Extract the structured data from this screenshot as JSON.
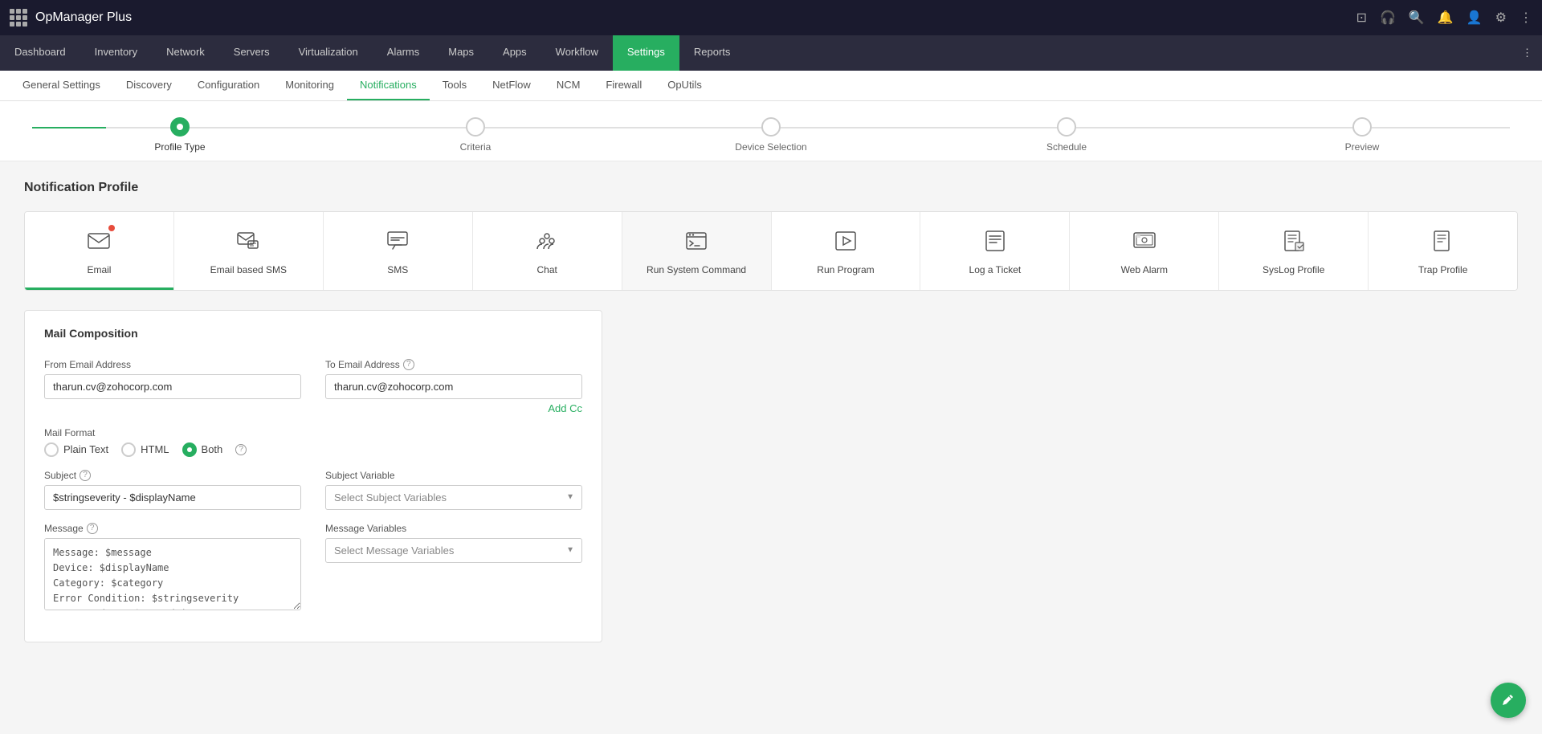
{
  "app": {
    "name": "OpManager Plus"
  },
  "topbar": {
    "icons": [
      "screen-icon",
      "bell-notification-icon",
      "search-icon",
      "bell-icon",
      "user-icon",
      "settings-icon",
      "more-icon"
    ]
  },
  "main_nav": {
    "items": [
      {
        "label": "Dashboard",
        "active": false
      },
      {
        "label": "Inventory",
        "active": false
      },
      {
        "label": "Network",
        "active": false
      },
      {
        "label": "Servers",
        "active": false
      },
      {
        "label": "Virtualization",
        "active": false
      },
      {
        "label": "Alarms",
        "active": false
      },
      {
        "label": "Maps",
        "active": false
      },
      {
        "label": "Apps",
        "active": false
      },
      {
        "label": "Workflow",
        "active": false
      },
      {
        "label": "Settings",
        "active": true
      },
      {
        "label": "Reports",
        "active": false
      }
    ]
  },
  "sub_nav": {
    "items": [
      {
        "label": "General Settings",
        "active": false
      },
      {
        "label": "Discovery",
        "active": false
      },
      {
        "label": "Configuration",
        "active": false
      },
      {
        "label": "Monitoring",
        "active": false
      },
      {
        "label": "Notifications",
        "active": true
      },
      {
        "label": "Tools",
        "active": false
      },
      {
        "label": "NetFlow",
        "active": false
      },
      {
        "label": "NCM",
        "active": false
      },
      {
        "label": "Firewall",
        "active": false
      },
      {
        "label": "OpUtils",
        "active": false
      }
    ]
  },
  "progress": {
    "steps": [
      {
        "label": "Profile Type",
        "active": true
      },
      {
        "label": "Criteria",
        "active": false
      },
      {
        "label": "Device Selection",
        "active": false
      },
      {
        "label": "Schedule",
        "active": false
      },
      {
        "label": "Preview",
        "active": false
      }
    ]
  },
  "page_title": "Notification Profile",
  "notification_types": [
    {
      "key": "email",
      "label": "Email",
      "icon": "email",
      "active": true,
      "badge": true
    },
    {
      "key": "email-sms",
      "label": "Email based SMS",
      "icon": "email-sms",
      "active": false,
      "badge": false
    },
    {
      "key": "sms",
      "label": "SMS",
      "icon": "sms",
      "active": false,
      "badge": false
    },
    {
      "key": "chat",
      "label": "Chat",
      "icon": "chat",
      "active": false,
      "badge": false,
      "dimmed": false
    },
    {
      "key": "run-system-command",
      "label": "Run System Command",
      "icon": "terminal",
      "active": false,
      "badge": false,
      "dimmed": true
    },
    {
      "key": "run-program",
      "label": "Run Program",
      "icon": "play",
      "active": false,
      "badge": false,
      "dimmed": false
    },
    {
      "key": "log-ticket",
      "label": "Log a Ticket",
      "icon": "ticket",
      "active": false,
      "badge": false,
      "dimmed": false
    },
    {
      "key": "web-alarm",
      "label": "Web Alarm",
      "icon": "web-alarm",
      "active": false,
      "badge": false,
      "dimmed": false
    },
    {
      "key": "syslog",
      "label": "SysLog Profile",
      "icon": "syslog",
      "active": false,
      "badge": false,
      "dimmed": false
    },
    {
      "key": "trap",
      "label": "Trap Profile",
      "icon": "trap",
      "active": false,
      "badge": false,
      "dimmed": false
    }
  ],
  "form": {
    "section_title": "Mail Composition",
    "from_label": "From Email Address",
    "from_value": "tharun.cv@zohocorp.com",
    "to_label": "To Email Address",
    "to_value": "tharun.cv@zohocorp.com",
    "add_cc": "Add Cc",
    "mail_format_label": "Mail Format",
    "mail_format_options": [
      {
        "label": "Plain Text",
        "value": "plain",
        "checked": false
      },
      {
        "label": "HTML",
        "value": "html",
        "checked": false
      },
      {
        "label": "Both",
        "value": "both",
        "checked": true
      }
    ],
    "subject_label": "Subject",
    "subject_value": "$stringseverity - $displayName",
    "subject_help": "?",
    "subject_variable_label": "Subject Variable",
    "subject_variable_placeholder": "Select Subject Variables",
    "message_label": "Message",
    "message_help": "?",
    "message_value": "Message: $message\nDevice: $displayName\nCategory: $category\nError Condition: $stringseverity\nGenerated at: $strModTime",
    "message_variable_label": "Message Variables",
    "message_variable_placeholder": "Select Message Variables"
  },
  "colors": {
    "green": "#27ae60",
    "dark_nav": "#2c2c3e",
    "topbar": "#1a1a2e"
  }
}
